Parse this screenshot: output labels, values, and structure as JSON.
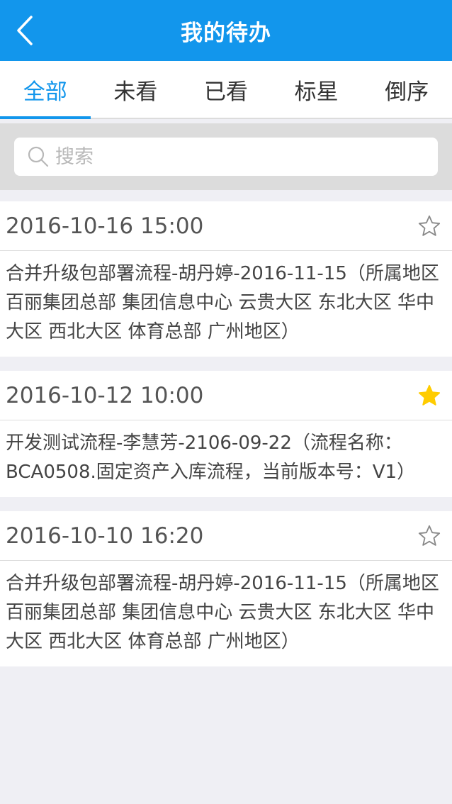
{
  "header": {
    "title": "我的待办",
    "back_icon": "chevron-left-icon"
  },
  "tabs": [
    {
      "label": "全部",
      "active": true
    },
    {
      "label": "未看",
      "active": false
    },
    {
      "label": "已看",
      "active": false
    },
    {
      "label": "标星",
      "active": false
    },
    {
      "label": "倒序",
      "active": false
    }
  ],
  "search": {
    "placeholder": "搜索",
    "value": "",
    "icon": "search-icon"
  },
  "items": [
    {
      "date": "2016-10-16 15:00",
      "starred": false,
      "text": "合并升级包部署流程-胡丹婷-2016-11-15（所属地区百丽集团总部 集团信息中心 云贵大区 东北大区 华中大区 西北大区 体育总部 广州地区）"
    },
    {
      "date": "2016-10-12 10:00",
      "starred": true,
      "text": "开发测试流程-李慧芳-2106-09-22（流程名称：BCA0508.固定资产入库流程，当前版本号：V1）"
    },
    {
      "date": "2016-10-10 16:20",
      "starred": false,
      "text": "合并升级包部署流程-胡丹婷-2016-11-15（所属地区百丽集团总部 集团信息中心 云贵大区 东北大区 华中大区 西北大区 体育总部 广州地区）"
    }
  ],
  "colors": {
    "primary": "#1296ec",
    "star_active": "#ffcc00",
    "star_inactive": "#888888"
  }
}
